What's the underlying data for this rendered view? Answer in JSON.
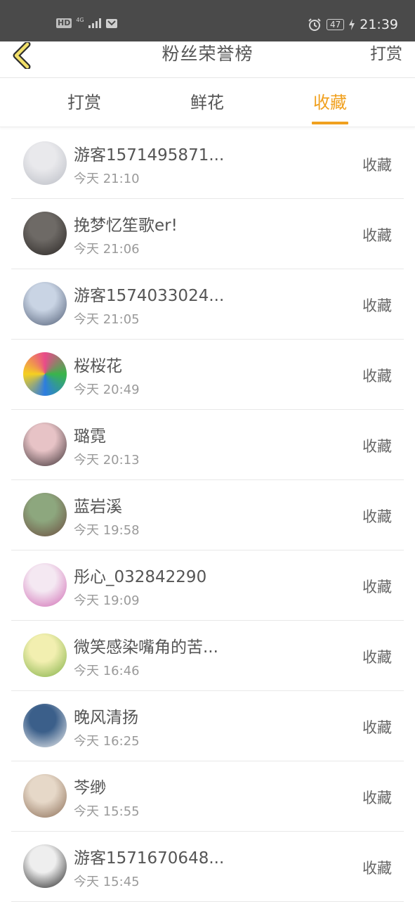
{
  "status_bar": {
    "left_badges": [
      "HD",
      "4G"
    ],
    "battery": "47",
    "time": "21:39",
    "icons": [
      "signal-icon",
      "app-notification-icon",
      "alarm-icon",
      "battery-icon",
      "charging-icon"
    ]
  },
  "header": {
    "title": "粉丝荣誉榜",
    "right_action": "打赏",
    "back_icon": "chevron-left-icon"
  },
  "tabs": [
    {
      "label": "打赏",
      "active": false
    },
    {
      "label": "鲜花",
      "active": false
    },
    {
      "label": "收藏",
      "active": true
    }
  ],
  "colors": {
    "accent": "#f0a01e",
    "status_bar_bg": "#4a4a4a",
    "back_icon_outline": "#2e2e2e",
    "back_icon_fill": "#f2e06a"
  },
  "fans": [
    {
      "name": "游客1571495871...",
      "time": "今天 21:10",
      "action": "收藏",
      "avatar_colors": [
        "#e9e9ec",
        "#b9bcc4"
      ]
    },
    {
      "name": "挽梦忆笙歌er!",
      "time": "今天 21:06",
      "action": "收藏",
      "avatar_colors": [
        "#6e6a66",
        "#2a2624"
      ]
    },
    {
      "name": "游客1574033024...",
      "time": "今天 21:05",
      "action": "收藏",
      "avatar_colors": [
        "#c9d4e4",
        "#4f5c74"
      ]
    },
    {
      "name": "桜桜花",
      "time": "今天 20:49",
      "action": "收藏",
      "avatar_colors": [
        "#e94b8a",
        "#39b54a",
        "#2d7de0",
        "#f5d020"
      ]
    },
    {
      "name": "璐霓",
      "time": "今天 20:13",
      "action": "收藏",
      "avatar_colors": [
        "#e7c3c6",
        "#3a2f33"
      ]
    },
    {
      "name": "蓝岩溪",
      "time": "今天 19:58",
      "action": "收藏",
      "avatar_colors": [
        "#8da77e",
        "#6b4b3e"
      ]
    },
    {
      "name": "彤心_032842290",
      "time": "今天 19:09",
      "action": "收藏",
      "avatar_colors": [
        "#f4e8f2",
        "#d06ab3"
      ]
    },
    {
      "name": "微笑感染嘴角的苦...",
      "time": "今天 16:46",
      "action": "收藏",
      "avatar_colors": [
        "#f2efb0",
        "#7faf45"
      ]
    },
    {
      "name": "晚风清扬",
      "time": "今天 16:25",
      "action": "收藏",
      "avatar_colors": [
        "#3b5f8a",
        "#f1f1f1"
      ]
    },
    {
      "name": "芩缈",
      "time": "今天 15:55",
      "action": "收藏",
      "avatar_colors": [
        "#e6d8c8",
        "#8a6c55"
      ]
    },
    {
      "name": "游客1571670648...",
      "time": "今天 15:45",
      "action": "收藏",
      "avatar_colors": [
        "#eeeeee",
        "#222222"
      ]
    }
  ]
}
